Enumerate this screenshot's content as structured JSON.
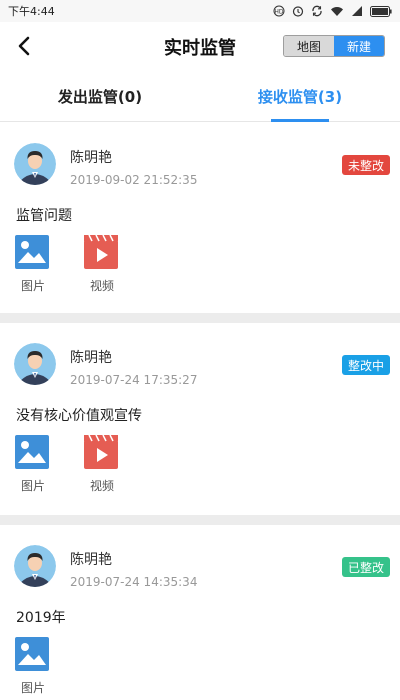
{
  "status_bar": {
    "time": "下午4:44"
  },
  "nav": {
    "title": "实时监管",
    "map_label": "地图",
    "new_label": "新建"
  },
  "tabs": [
    {
      "label": "发出监管(0)"
    },
    {
      "label": "接收监管(3)"
    }
  ],
  "records": [
    {
      "name": "陈明艳",
      "time": "2019-09-02 21:52:35",
      "status": "未整改",
      "status_color": "#e3473e",
      "content": "监管问题",
      "image_label": "图片",
      "video_label": "视频"
    },
    {
      "name": "陈明艳",
      "time": "2019-07-24 17:35:27",
      "status": "整改中",
      "status_color": "#1aa0e6",
      "content": "没有核心价值观宣传",
      "image_label": "图片",
      "video_label": "视频"
    },
    {
      "name": "陈明艳",
      "time": "2019-07-24 14:35:34",
      "status": "已整改",
      "status_color": "#35c28a",
      "content": "2019年",
      "image_label": "图片"
    }
  ],
  "colors": {
    "accent": "#2d8ff0",
    "image_icon": "#3e8fd8",
    "video_icon": "#e55d53"
  }
}
